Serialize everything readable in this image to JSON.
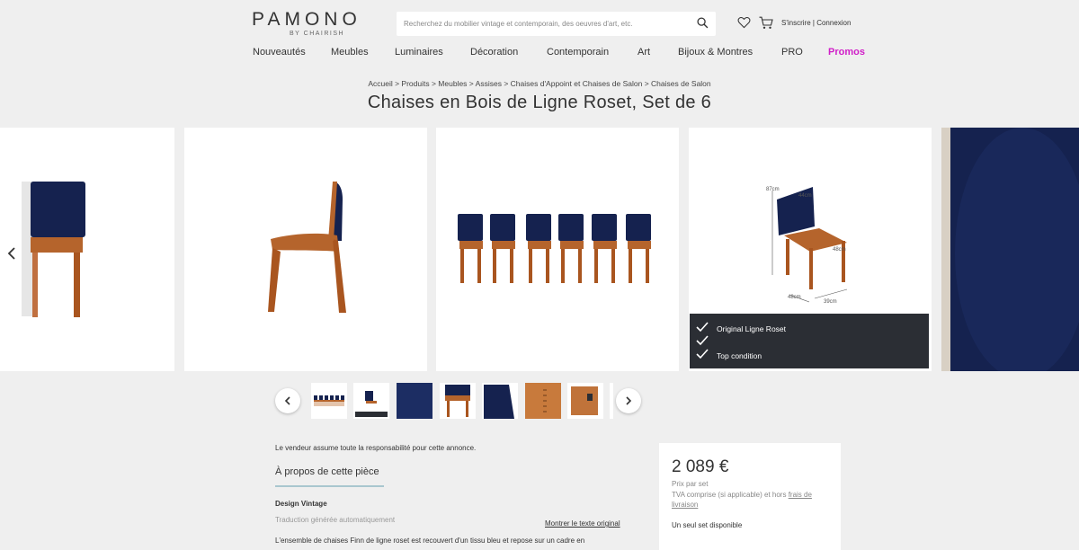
{
  "header": {
    "logo": "PAMONO",
    "logo_sub": "BY CHAIRISH",
    "search_placeholder": "Recherchez du mobilier vintage et contemporain, des oeuvres d'art, etc.",
    "signup": "S'inscrire",
    "separator": " | ",
    "login": "Connexion"
  },
  "nav": [
    "Nouveautés",
    "Meubles",
    "Luminaires",
    "Décoration",
    "Contemporain",
    "Art",
    "Bijoux & Montres",
    "PRO",
    "Promos"
  ],
  "breadcrumb": [
    "Accueil",
    "Produits",
    "Meubles",
    "Assises",
    "Chaises d'Appoint et Chaises de Salon",
    "Chaises de Salon"
  ],
  "breadcrumb_sep": " > ",
  "title": "Chaises en Bois de Ligne Roset, Set de 6",
  "gallery": {
    "dims": {
      "height": "87cm",
      "seat_width": "44cm",
      "seat_height": "48cm",
      "depth": "48cm",
      "width": "39cm"
    },
    "overlay": [
      "Original Ligne Roset",
      "Top condition"
    ]
  },
  "details": {
    "seller_note": "Le vendeur assume toute la responsabilité pour cette annonce.",
    "about_title": "À propos de cette pièce",
    "design_label": "Design Vintage",
    "auto_translation": "Traduction générée automatiquement",
    "show_original": "Montrer le texte original",
    "description": "L'ensemble de chaises Finn de ligne roset est recouvert d'un tissu bleu et repose sur un cadre en"
  },
  "price_box": {
    "price": "2 089 €",
    "per": "Prix par set",
    "vat_prefix": "TVA comprise (si applicable) et hors ",
    "vat_link": "frais de livraison",
    "availability": "Un seul set disponible"
  },
  "colors": {
    "accent": "#d01ec8",
    "underline": "#a9c7cf",
    "overlay": "#2b2e34",
    "navy": "#15224f",
    "wood": "#b5642c"
  }
}
